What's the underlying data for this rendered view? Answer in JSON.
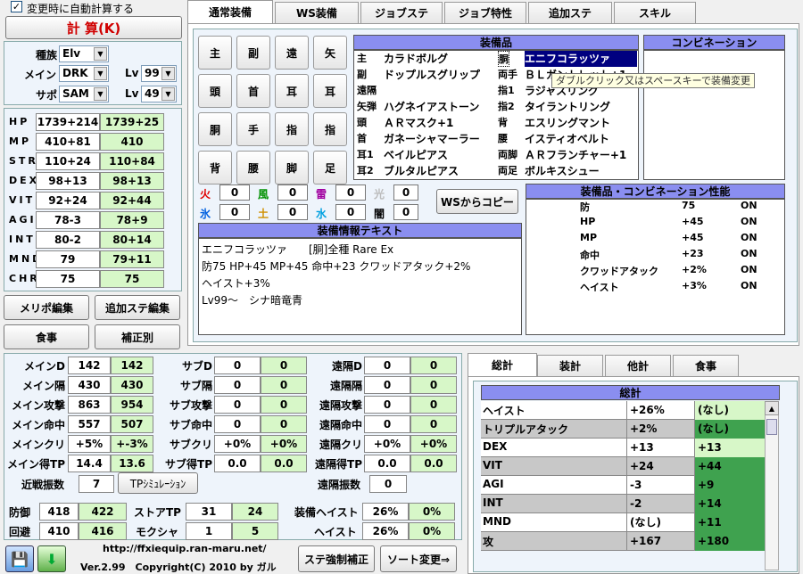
{
  "auto_calc": {
    "label": "変更時に自動計算する",
    "checked": true
  },
  "calc_button": "計 算(K)",
  "profile": {
    "race_label": "種族",
    "race": "Elv",
    "main_label": "メイン",
    "main_job": "DRK",
    "main_lv_label": "Lv",
    "main_lv": "99",
    "sub_label": "サポ",
    "sub_job": "SAM",
    "sub_lv_label": "Lv",
    "sub_lv": "49"
  },
  "stats": [
    {
      "name": "HP",
      "base": "1739+214",
      "total": "1739+25"
    },
    {
      "name": "MP",
      "base": "410+81",
      "total": "410"
    },
    {
      "name": "STR",
      "base": "110+24",
      "total": "110+84"
    },
    {
      "name": "DEX",
      "base": "98+13",
      "total": "98+13"
    },
    {
      "name": "VIT",
      "base": "92+24",
      "total": "92+44"
    },
    {
      "name": "AGI",
      "base": "78-3",
      "total": "78+9"
    },
    {
      "name": "INT",
      "base": "80-2",
      "total": "80+14"
    },
    {
      "name": "MND",
      "base": "79",
      "total": "79+11"
    },
    {
      "name": "CHR",
      "base": "75",
      "total": "75"
    }
  ],
  "left_buttons": [
    "メリポ編集",
    "追加ステ編集",
    "食事",
    "補正別"
  ],
  "tabs": [
    "通常装備",
    "WS装備",
    "ジョブステ",
    "ジョブ特性",
    "追加ステ",
    "スキル"
  ],
  "slots": [
    "主",
    "副",
    "遠",
    "矢",
    "頭",
    "首",
    "耳",
    "耳",
    "胴",
    "手",
    "指",
    "指",
    "背",
    "腰",
    "脚",
    "足"
  ],
  "equip_header": "装備品",
  "equip_left": [
    {
      "slot": "主",
      "item": "カラドボルグ"
    },
    {
      "slot": "副",
      "item": "ドップルスグリップ"
    },
    {
      "slot": "遠隔",
      "item": ""
    },
    {
      "slot": "矢弾",
      "item": "ハグネイアストーン"
    },
    {
      "slot": "頭",
      "item": "ＡＲマスク+1"
    },
    {
      "slot": "首",
      "item": "ガネーシャマーラー"
    },
    {
      "slot": "耳1",
      "item": "ベイルピアス"
    },
    {
      "slot": "耳2",
      "item": "ブルタルピアス"
    }
  ],
  "equip_right": [
    {
      "slot": "胴",
      "item": "エニフコラッツァ"
    },
    {
      "slot": "両手",
      "item": "ＢＬガントレット+1"
    },
    {
      "slot": "指1",
      "item": "ラジャスリング"
    },
    {
      "slot": "指2",
      "item": "タイラントリング"
    },
    {
      "slot": "背",
      "item": "エスリングマント"
    },
    {
      "slot": "腰",
      "item": "イスティオベルト"
    },
    {
      "slot": "両脚",
      "item": "ＡＲフランチャー+1"
    },
    {
      "slot": "両足",
      "item": "ボルキスシュー"
    }
  ],
  "tooltip": "ダブルクリック又はスペースキーで装備変更",
  "combination_header": "コンビネーション",
  "elements": [
    {
      "name": "火",
      "value": "0",
      "color": "#e00000"
    },
    {
      "name": "風",
      "value": "0",
      "color": "#009000"
    },
    {
      "name": "雷",
      "value": "0",
      "color": "#a000a0"
    },
    {
      "name": "光",
      "value": "0",
      "color": "#bbbbbb"
    },
    {
      "name": "氷",
      "value": "0",
      "color": "#0060e0"
    },
    {
      "name": "土",
      "value": "0",
      "color": "#d09000"
    },
    {
      "name": "水",
      "value": "0",
      "color": "#00a0e0"
    },
    {
      "name": "闇",
      "value": "0",
      "color": "#000000"
    }
  ],
  "ws_copy": "WSからコピー",
  "info_header": "装備情報テキスト",
  "info_lines": [
    "エニフコラッツァ　　[胴]全種 Rare Ex",
    "防75 HP+45 MP+45 命中+23 クワッドアタック+2%",
    "ヘイスト+3%",
    "Lv99～　シナ暗竜青"
  ],
  "perf_header": "装備品・コンビネーション性能",
  "perf_rows": [
    {
      "name": "防",
      "value": "75",
      "flag": "ON"
    },
    {
      "name": "HP",
      "value": "+45",
      "flag": "ON"
    },
    {
      "name": "MP",
      "value": "+45",
      "flag": "ON"
    },
    {
      "name": "命中",
      "value": "+23",
      "flag": "ON"
    },
    {
      "name": "クワッドアタック",
      "value": "+2%",
      "flag": "ON"
    },
    {
      "name": "ヘイスト",
      "value": "+3%",
      "flag": "ON"
    }
  ],
  "battle": {
    "main": [
      {
        "label": "メインD",
        "a": "142",
        "b": "142"
      },
      {
        "label": "メイン隔",
        "a": "430",
        "b": "430"
      },
      {
        "label": "メイン攻撃",
        "a": "863",
        "b": "954"
      },
      {
        "label": "メイン命中",
        "a": "557",
        "b": "507"
      },
      {
        "label": "メインクリ",
        "a": "+5%",
        "b": "+-3%"
      },
      {
        "label": "メイン得TP",
        "a": "14.4",
        "b": "13.6"
      }
    ],
    "sub": [
      {
        "label": "サブD",
        "a": "0",
        "b": "0"
      },
      {
        "label": "サブ隔",
        "a": "0",
        "b": "0"
      },
      {
        "label": "サブ攻撃",
        "a": "0",
        "b": "0"
      },
      {
        "label": "サブ命中",
        "a": "0",
        "b": "0"
      },
      {
        "label": "サブクリ",
        "a": "+0%",
        "b": "+0%"
      },
      {
        "label": "サブ得TP",
        "a": "0.0",
        "b": "0.0"
      }
    ],
    "ranged": [
      {
        "label": "遠隔D",
        "a": "0",
        "b": "0"
      },
      {
        "label": "遠隔隔",
        "a": "0",
        "b": "0"
      },
      {
        "label": "遠隔攻撃",
        "a": "0",
        "b": "0"
      },
      {
        "label": "遠隔命中",
        "a": "0",
        "b": "0"
      },
      {
        "label": "遠隔クリ",
        "a": "+0%",
        "b": "+0%"
      },
      {
        "label": "遠隔得TP",
        "a": "0.0",
        "b": "0.0"
      }
    ],
    "melee_hits_label": "近戦振数",
    "melee_hits": "7",
    "tp_sim": "TPｼﾐｭﾚｰｼｮﾝ",
    "ranged_hits_label": "遠隔振数",
    "ranged_hits": "0",
    "defense_label": "防御",
    "defense_a": "418",
    "defense_b": "422",
    "store_tp_label": "ストアTP",
    "store_tp_a": "31",
    "store_tp_b": "24",
    "equip_haste_label": "装備ヘイスト",
    "equip_haste_a": "26%",
    "equip_haste_b": "0%",
    "evasion_label": "回避",
    "evasion_a": "410",
    "evasion_b": "416",
    "mokusha_label": "モクシャ",
    "mokusha_a": "1",
    "mokusha_b": "5",
    "haste_label": "ヘイスト",
    "haste_a": "26%",
    "haste_b": "0%"
  },
  "footer": {
    "url": "http://ffxiequip.ran-maru.net/",
    "version": "Ver.2.99　Copyright(C) 2010 by ガル",
    "force_button": "ステ強制補正",
    "sort_button": "ソート変更⇒"
  },
  "sum_tabs": [
    "総計",
    "装計",
    "他計",
    "食事"
  ],
  "sum_header": "総計",
  "sum_rows": [
    {
      "name": "ヘイスト",
      "a": "+26%",
      "b": "(なし)"
    },
    {
      "name": "トリプルアタック",
      "a": "+2%",
      "b": "(なし)"
    },
    {
      "name": "DEX",
      "a": "+13",
      "b": "+13"
    },
    {
      "name": "VIT",
      "a": "+24",
      "b": "+44"
    },
    {
      "name": "AGI",
      "a": "-3",
      "b": "+9"
    },
    {
      "name": "INT",
      "a": "-2",
      "b": "+14"
    },
    {
      "name": "MND",
      "a": "(なし)",
      "b": "+11"
    },
    {
      "name": "攻",
      "a": "+167",
      "b": "+180"
    }
  ]
}
